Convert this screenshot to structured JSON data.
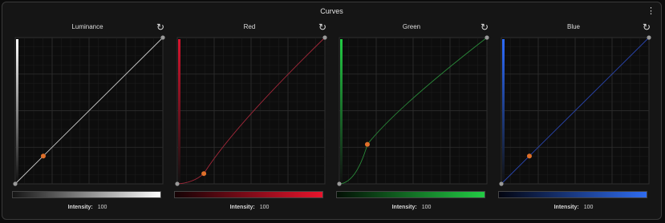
{
  "window": {
    "title": "Curves"
  },
  "panels": [
    {
      "key": "luminance",
      "title": "Luminance",
      "color": "#cccccc",
      "sideColor": "#ffffff",
      "gradient": [
        "#151515",
        "#ffffff"
      ],
      "points": [
        [
          0,
          0
        ],
        [
          0.19,
          0.19
        ],
        [
          1,
          1
        ]
      ],
      "curve": "linear",
      "active_point_index": 1,
      "intensity_label": "Intensity:",
      "intensity_value": "100"
    },
    {
      "key": "red",
      "title": "Red",
      "color": "#a3283a",
      "sideColor": "#d8142e",
      "gradient": [
        "#150305",
        "#e8142c"
      ],
      "points": [
        [
          0,
          0
        ],
        [
          0.18,
          0.07
        ],
        [
          1,
          1
        ]
      ],
      "curve": "smooth",
      "active_point_index": 1,
      "intensity_label": "Intensity:",
      "intensity_value": "100"
    },
    {
      "key": "green",
      "title": "Green",
      "color": "#2a8a3a",
      "sideColor": "#22cc44",
      "gradient": [
        "#031005",
        "#22cc44"
      ],
      "points": [
        [
          0,
          0
        ],
        [
          0.19,
          0.27
        ],
        [
          1,
          1
        ]
      ],
      "curve": "smooth",
      "active_point_index": 1,
      "intensity_label": "Intensity:",
      "intensity_value": "100"
    },
    {
      "key": "blue",
      "title": "Blue",
      "color": "#2a46b0",
      "sideColor": "#2d6cff",
      "gradient": [
        "#030510",
        "#2f6cf0"
      ],
      "points": [
        [
          0,
          0
        ],
        [
          0.19,
          0.19
        ],
        [
          1,
          1
        ]
      ],
      "curve": "linear",
      "active_point_index": 1,
      "intensity_label": "Intensity:",
      "intensity_value": "100"
    }
  ],
  "accent": "#e0702a",
  "icons": {
    "menu": "vertical-dots-icon",
    "reset": "reset-icon"
  }
}
